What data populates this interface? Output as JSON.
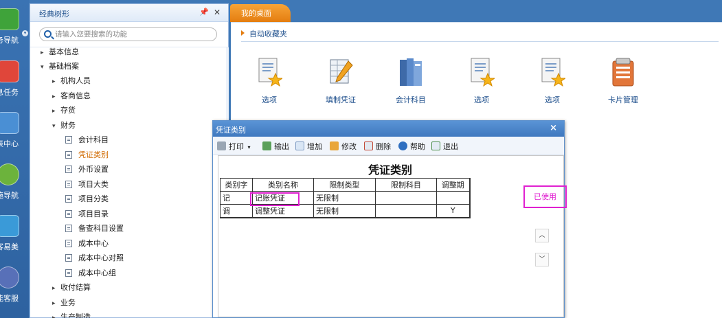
{
  "rail": {
    "items": [
      {
        "label": "务导航",
        "icon": "grid-icon",
        "color": "#3fa33a"
      },
      {
        "label": "息任务",
        "icon": "mail-icon",
        "color": "#e0463a"
      },
      {
        "label": "表中心",
        "icon": "chart-icon",
        "color": "#4a8fd4"
      },
      {
        "label": "施导航",
        "icon": "compass-icon",
        "color": "#6cb33c"
      },
      {
        "label": "客易美",
        "icon": "cube-icon",
        "color": "#3a9ad8"
      },
      {
        "label": "能客服",
        "icon": "headset-icon",
        "color": "#5870b8"
      }
    ]
  },
  "tree": {
    "title": "经典树形",
    "pin_icon": "pin-icon",
    "close_icon": "close-icon",
    "search_placeholder": "请输入您要搜索的功能",
    "nodes": [
      {
        "label": "基本信息",
        "arrow": "▸",
        "level": 0
      },
      {
        "label": "基础档案",
        "arrow": "▾",
        "level": 0
      },
      {
        "label": "机构人员",
        "arrow": "▸",
        "level": 1
      },
      {
        "label": "客商信息",
        "arrow": "▸",
        "level": 1
      },
      {
        "label": "存货",
        "arrow": "▸",
        "level": 1
      },
      {
        "label": "财务",
        "arrow": "▾",
        "level": 1
      },
      {
        "label": "会计科目",
        "doc": true,
        "level": 2
      },
      {
        "label": "凭证类别",
        "doc": true,
        "level": 2,
        "active": true
      },
      {
        "label": "外币设置",
        "doc": true,
        "level": 2
      },
      {
        "label": "项目大类",
        "doc": true,
        "level": 2
      },
      {
        "label": "项目分类",
        "doc": true,
        "level": 2
      },
      {
        "label": "项目目录",
        "doc": true,
        "level": 2
      },
      {
        "label": "备查科目设置",
        "doc": true,
        "level": 2
      },
      {
        "label": "成本中心",
        "doc": true,
        "level": 2
      },
      {
        "label": "成本中心对照",
        "doc": true,
        "level": 2
      },
      {
        "label": "成本中心组",
        "doc": true,
        "level": 2
      },
      {
        "label": "收付结算",
        "arrow": "▸",
        "level": 1
      },
      {
        "label": "业务",
        "arrow": "▸",
        "level": 1
      },
      {
        "label": "生产制造",
        "arrow": "▸",
        "level": 1
      }
    ]
  },
  "tabs": {
    "desktop": "我的桌面"
  },
  "favorites": {
    "title": "自动收藏夹",
    "items": [
      {
        "label": "选项",
        "icon": "options-doc-icon"
      },
      {
        "label": "填制凭证",
        "icon": "voucher-edit-icon"
      },
      {
        "label": "会计科目",
        "icon": "books-icon"
      },
      {
        "label": "选项",
        "icon": "options-doc-icon"
      },
      {
        "label": "选项",
        "icon": "options-doc-icon"
      },
      {
        "label": "卡片管理",
        "icon": "card-folder-icon"
      }
    ]
  },
  "dialog": {
    "title": "凭证类别",
    "heading": "凭证类别",
    "toolbar": {
      "print": "打印",
      "export": "输出",
      "add": "增加",
      "modify": "修改",
      "delete": "删除",
      "help": "帮助",
      "exit": "退出"
    },
    "columns": [
      "类别字",
      "类别名称",
      "限制类型",
      "限制科目",
      "调整期"
    ],
    "rows": [
      [
        "记",
        "记账凭证",
        "无限制",
        "",
        ""
      ],
      [
        "调",
        "调整凭证",
        "无限制",
        "",
        "Y"
      ]
    ],
    "used_badge": "已使用",
    "nav_up": "︿",
    "nav_down": "﹀"
  },
  "colors": {
    "accent": "#e47d10",
    "highlight": "#e020d0",
    "title_blue": "#1e4f8c"
  }
}
